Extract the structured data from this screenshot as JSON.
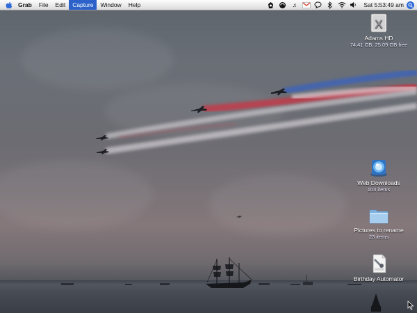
{
  "menubar": {
    "app": "Grab",
    "items": [
      "File",
      "Edit",
      "Capture",
      "Window",
      "Help"
    ],
    "active_item": "Capture",
    "clock": "Sat 5:53:49 am"
  },
  "desktop_icons": [
    {
      "label": "Adams HD",
      "sub": "74.41 GB, 25.09 GB free",
      "icon": "hard-drive-icon"
    },
    {
      "label": "Web Downloads",
      "sub": "103 items",
      "icon": "downloads-stack-icon"
    },
    {
      "label": "Pictures to rename",
      "sub": "23 items",
      "icon": "folder-icon"
    },
    {
      "label": "Birthday Automator",
      "sub": "",
      "icon": "workflow-icon"
    }
  ],
  "colors": {
    "menu_highlight": "#2b61c9",
    "smoke_blue": "#3d63b8",
    "smoke_red": "#c23a48",
    "smoke_white": "#e9e6ea"
  }
}
